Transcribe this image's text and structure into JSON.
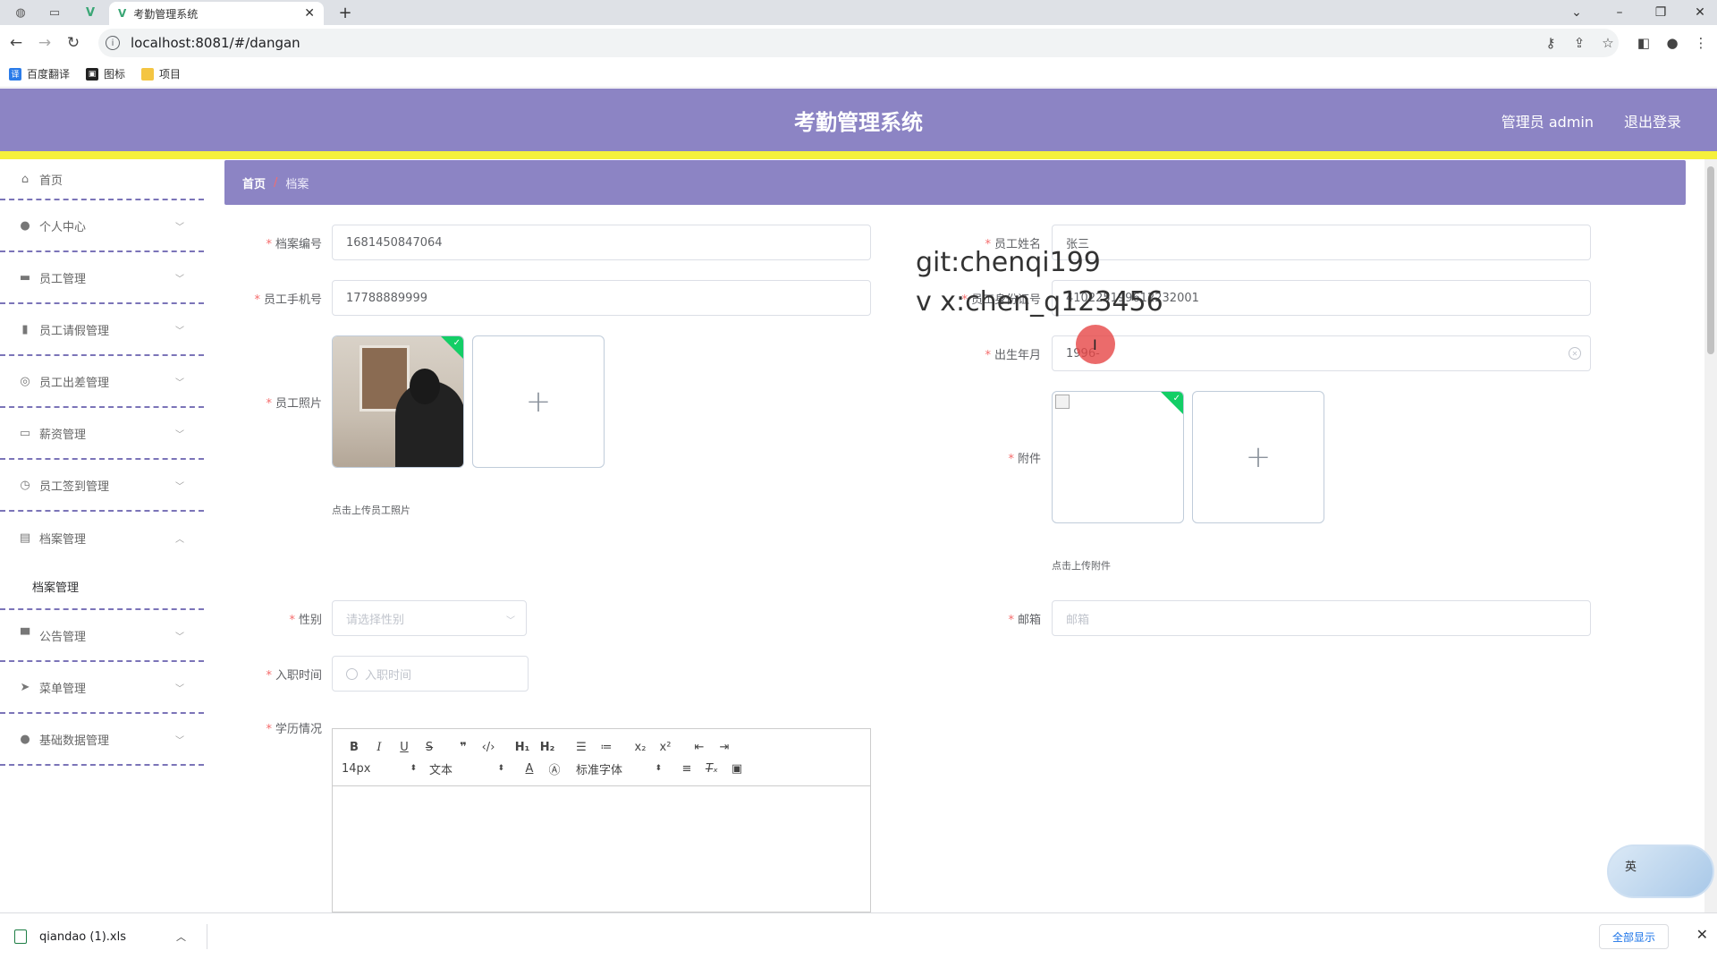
{
  "browser": {
    "tab_title": "考勤管理系统",
    "url": "localhost:8081/#/dangan",
    "bookmarks": [
      "百度翻译",
      "图标",
      "项目"
    ]
  },
  "header": {
    "title": "考勤管理系统",
    "user": "管理员 admin",
    "logout": "退出登录"
  },
  "sidebar": {
    "items": [
      {
        "label": "首页",
        "icon": "home-icon"
      },
      {
        "label": "个人中心",
        "icon": "user-icon"
      },
      {
        "label": "员工管理",
        "icon": "briefcase-icon"
      },
      {
        "label": "员工请假管理",
        "icon": "bar-chart-icon"
      },
      {
        "label": "员工出差管理",
        "icon": "target-icon"
      },
      {
        "label": "薪资管理",
        "icon": "suitcase-icon"
      },
      {
        "label": "员工签到管理",
        "icon": "clock-icon"
      },
      {
        "label": "档案管理",
        "icon": "clipboard-icon"
      },
      {
        "label": "公告管理",
        "icon": "monitor-icon"
      },
      {
        "label": "菜单管理",
        "icon": "send-icon"
      },
      {
        "label": "基础数据管理",
        "icon": "user-icon"
      }
    ],
    "active_sub": "档案管理"
  },
  "breadcrumb": {
    "home": "首页",
    "current": "档案"
  },
  "form": {
    "archive_no_label": "档案编号",
    "archive_no": "1681450847064",
    "name_label": "员工姓名",
    "name": "张三",
    "phone_label": "员工手机号",
    "phone": "17788889999",
    "id_label": "员工身份证号",
    "id_value": "410225199612232001",
    "photo_label": "员工照片",
    "photo_tip": "点击上传员工照片",
    "birth_label": "出生年月",
    "birth": "1996-",
    "attach_label": "附件",
    "attach_tip": "点击上传附件",
    "gender_label": "性别",
    "gender_placeholder": "请选择性别",
    "email_label": "邮箱",
    "email_placeholder": "邮箱",
    "hire_label": "入职时间",
    "hire_placeholder": "入职时间",
    "edu_label": "学历情况"
  },
  "editor": {
    "font_size": "14px",
    "text_style": "文本",
    "font_family": "标准字体"
  },
  "watermark": {
    "line1": "git:chenqi199",
    "line2": "v x:chen_q123456"
  },
  "floaty": {
    "text": "英"
  },
  "downloads": {
    "file": "qiandao (1).xls",
    "show_all": "全部显示"
  }
}
